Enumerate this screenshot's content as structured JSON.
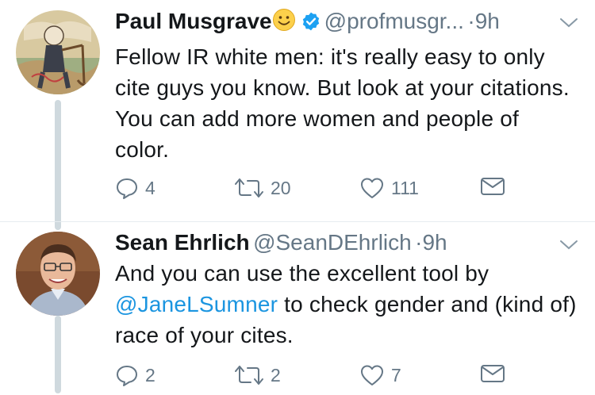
{
  "tweets": [
    {
      "name": "Paul Musgrave",
      "emoji": "smiling-face",
      "verified": true,
      "handle": "@profmusgr...",
      "dot": "·",
      "time": "9h",
      "text": "Fellow IR white men: it's really easy to only cite guys you know. But look at your citations. You can add more women and people of color.",
      "replies": "4",
      "retweets": "20",
      "likes": "111"
    },
    {
      "name": "Sean Ehrlich",
      "handle": "@SeanDEhrlich",
      "dot": "·",
      "time": "9h",
      "text_before": "And you can use the excellent tool by ",
      "mention": "@JaneLSumner",
      "text_after": " to check gender and (kind of) race of your cites.",
      "replies": "2",
      "retweets": "2",
      "likes": "7"
    }
  ],
  "colors": {
    "accent": "#1b95e0",
    "muted": "#657786",
    "text": "#14171a",
    "thread": "#cfd9de"
  }
}
